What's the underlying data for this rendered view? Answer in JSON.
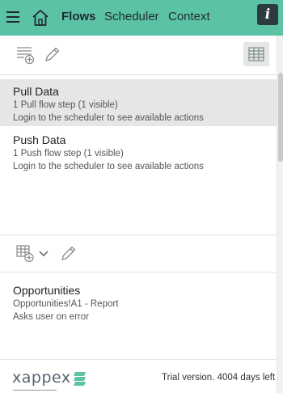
{
  "nav": {
    "tabs": [
      "Flows",
      "Scheduler",
      "Context"
    ],
    "active_tab": "Flows",
    "info_label": "i"
  },
  "flows": [
    {
      "title": "Pull Data",
      "steps": "1 Pull flow step (1 visible)",
      "note": "Login to the scheduler to see available actions",
      "selected": true
    },
    {
      "title": "Push Data",
      "steps": "1 Push flow step (1 visible)",
      "note": "Login to the scheduler to see available actions",
      "selected": false
    }
  ],
  "steps": [
    {
      "title": "Opportunities",
      "range": "Opportunities!A1 - Report",
      "error_mode": "Asks user on error"
    }
  ],
  "footer": {
    "logo_text": "xappex",
    "trial": "Trial version. 4004 days left"
  },
  "colors": {
    "accent": "#5cc2a6",
    "selected_row": "#e6e6e6",
    "icon": "#8a8a8a"
  },
  "icons": {
    "menu": "hamburger-icon",
    "home": "home-icon",
    "info": "info-icon",
    "add_flow": "add-list-icon",
    "edit": "pencil-icon",
    "grid": "grid-table-icon",
    "add_step": "add-table-icon",
    "dropdown": "chevron-down-icon"
  }
}
